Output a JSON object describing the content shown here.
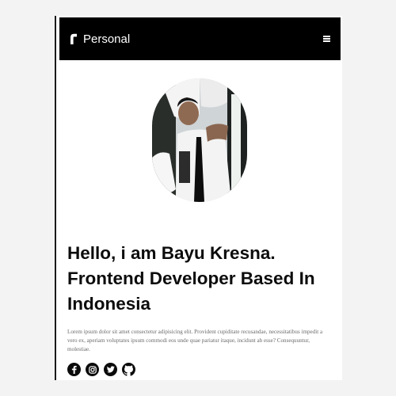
{
  "navbar": {
    "brand_text": "Personal",
    "brand_icon": "brand-logo-icon",
    "menu_icon": "hamburger-menu-icon"
  },
  "hero": {
    "heading_lines": [
      "Hello, i am Bayu Kresna.",
      "Frontend Developer Based In",
      "Indonesia"
    ],
    "bio": "Lorem ipsum dolor sit amet consectetur adipisicing elit. Provident cupiditate recusandae, necessitatibus impedit a vero ex, aperiam voluptates ipsum commodi eos unde quae pariatur itaque, incidunt ab esse? Consequuntur, molestiae."
  },
  "socials": [
    {
      "icon": "facebook-icon"
    },
    {
      "icon": "instagram-icon"
    },
    {
      "icon": "twitter-icon"
    },
    {
      "icon": "github-icon"
    }
  ],
  "colors": {
    "navbar_bg": "#000000",
    "heading": "#0c0c0c",
    "bio_text": "#6a6a6a",
    "page_bg": "#ffffff"
  }
}
